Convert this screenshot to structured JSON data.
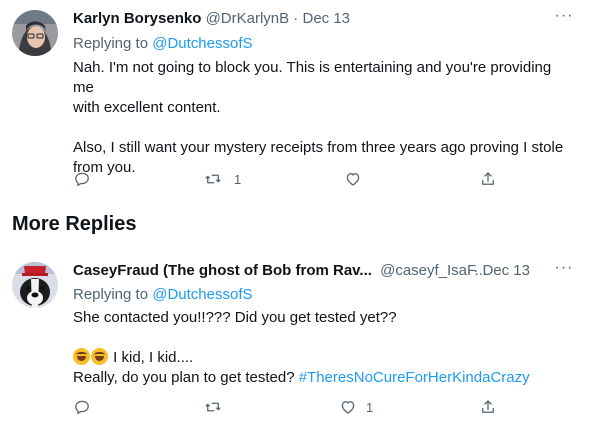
{
  "tweet1": {
    "name": "Karlyn Borysenko",
    "handle": "@DrKarlynB",
    "sep": " · ",
    "date": "Dec 13",
    "more": "···",
    "replying_prefix": "Replying to ",
    "replying_handle": "@DutchessofS",
    "body_line1": "Nah. I'm not going to block you. This is entertaining and you're providing me",
    "body_line2": "with excellent content.",
    "body_line3": "Also, I still want your mystery receipts from three years ago proving I stole",
    "body_line4": "from you.",
    "retweet_count": "1"
  },
  "section": {
    "title": "More Replies"
  },
  "tweet2": {
    "name": "CaseyFraud (The ghost of Bob from Rav...",
    "handle": "@caseyf_IsaF...",
    "sep": " · ",
    "date": "Dec 13",
    "more": "···",
    "replying_prefix": "Replying to ",
    "replying_handle": "@DutchessofS",
    "body_line1": "She contacted you!!??? Did you get tested yet??",
    "body_line2_text": " I kid, I kid....",
    "body_line3_text": "Really, do you plan to get tested? ",
    "hashtag": "#TheresNoCureForHerKindaCrazy",
    "like_count": "1"
  },
  "icons": {
    "reply": "reply-icon",
    "retweet": "retweet-icon",
    "like": "heart-icon",
    "share": "share-icon",
    "emoji": "rolling-on-floor-laughing-emoji"
  },
  "colors": {
    "text": "#0f1419",
    "secondary": "#536471",
    "link": "#1d9bf0"
  }
}
